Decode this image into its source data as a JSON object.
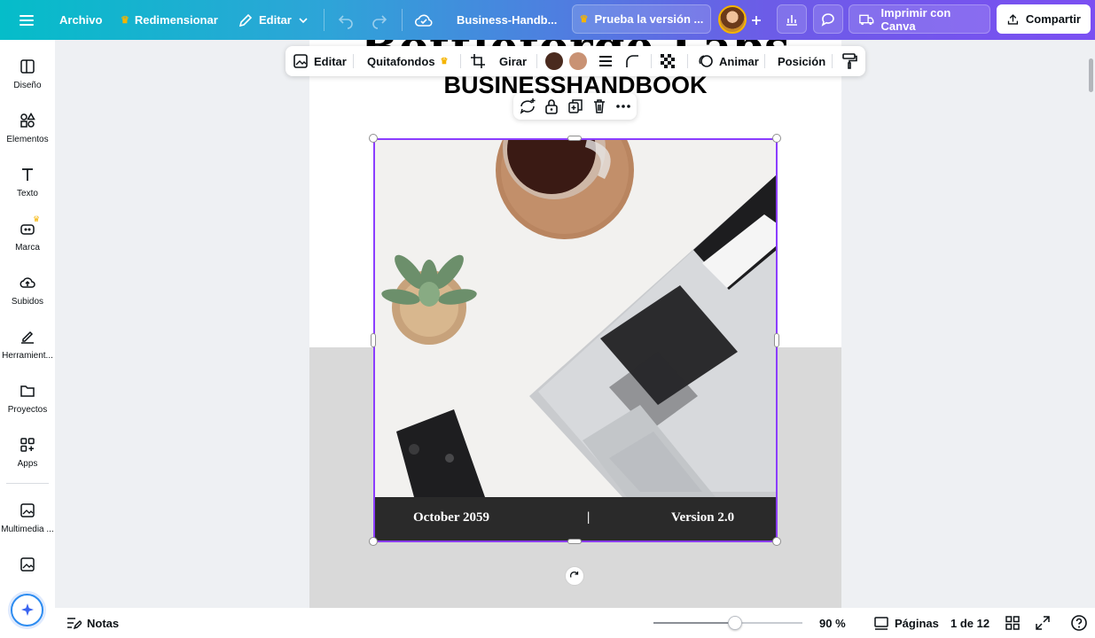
{
  "topbar": {
    "file": "Archivo",
    "resize": "Redimensionar",
    "edit": "Editar",
    "doc_title": "Business-Handb...",
    "trial": "Prueba la versión ...",
    "print": "Imprimir con Canva",
    "share": "Compartir"
  },
  "sidebar": {
    "items": [
      {
        "label": "Diseño"
      },
      {
        "label": "Elementos"
      },
      {
        "label": "Texto"
      },
      {
        "label": "Marca"
      },
      {
        "label": "Subidos"
      },
      {
        "label": "Herramient..."
      },
      {
        "label": "Proyectos"
      },
      {
        "label": "Apps"
      },
      {
        "label": "Multimedia ..."
      }
    ]
  },
  "context_toolbar": {
    "edit": "Editar",
    "bg_remove": "Quitafondos",
    "flip": "Girar",
    "animate": "Animar",
    "position": "Posición",
    "colors": [
      "#4a2a1e",
      "#c99274"
    ]
  },
  "page": {
    "title_partial": "Bottleforge Labs",
    "subtitle": "BUSINESSHANDBOOK",
    "footer_left": "October 2059",
    "footer_sep": "|",
    "footer_right": "Version 2.0"
  },
  "bottombar": {
    "notes": "Notas",
    "zoom": "90 %",
    "zoom_level": 0.55,
    "pages": "Páginas",
    "page_count": "1 de 12"
  },
  "accent": "#8b3dff"
}
